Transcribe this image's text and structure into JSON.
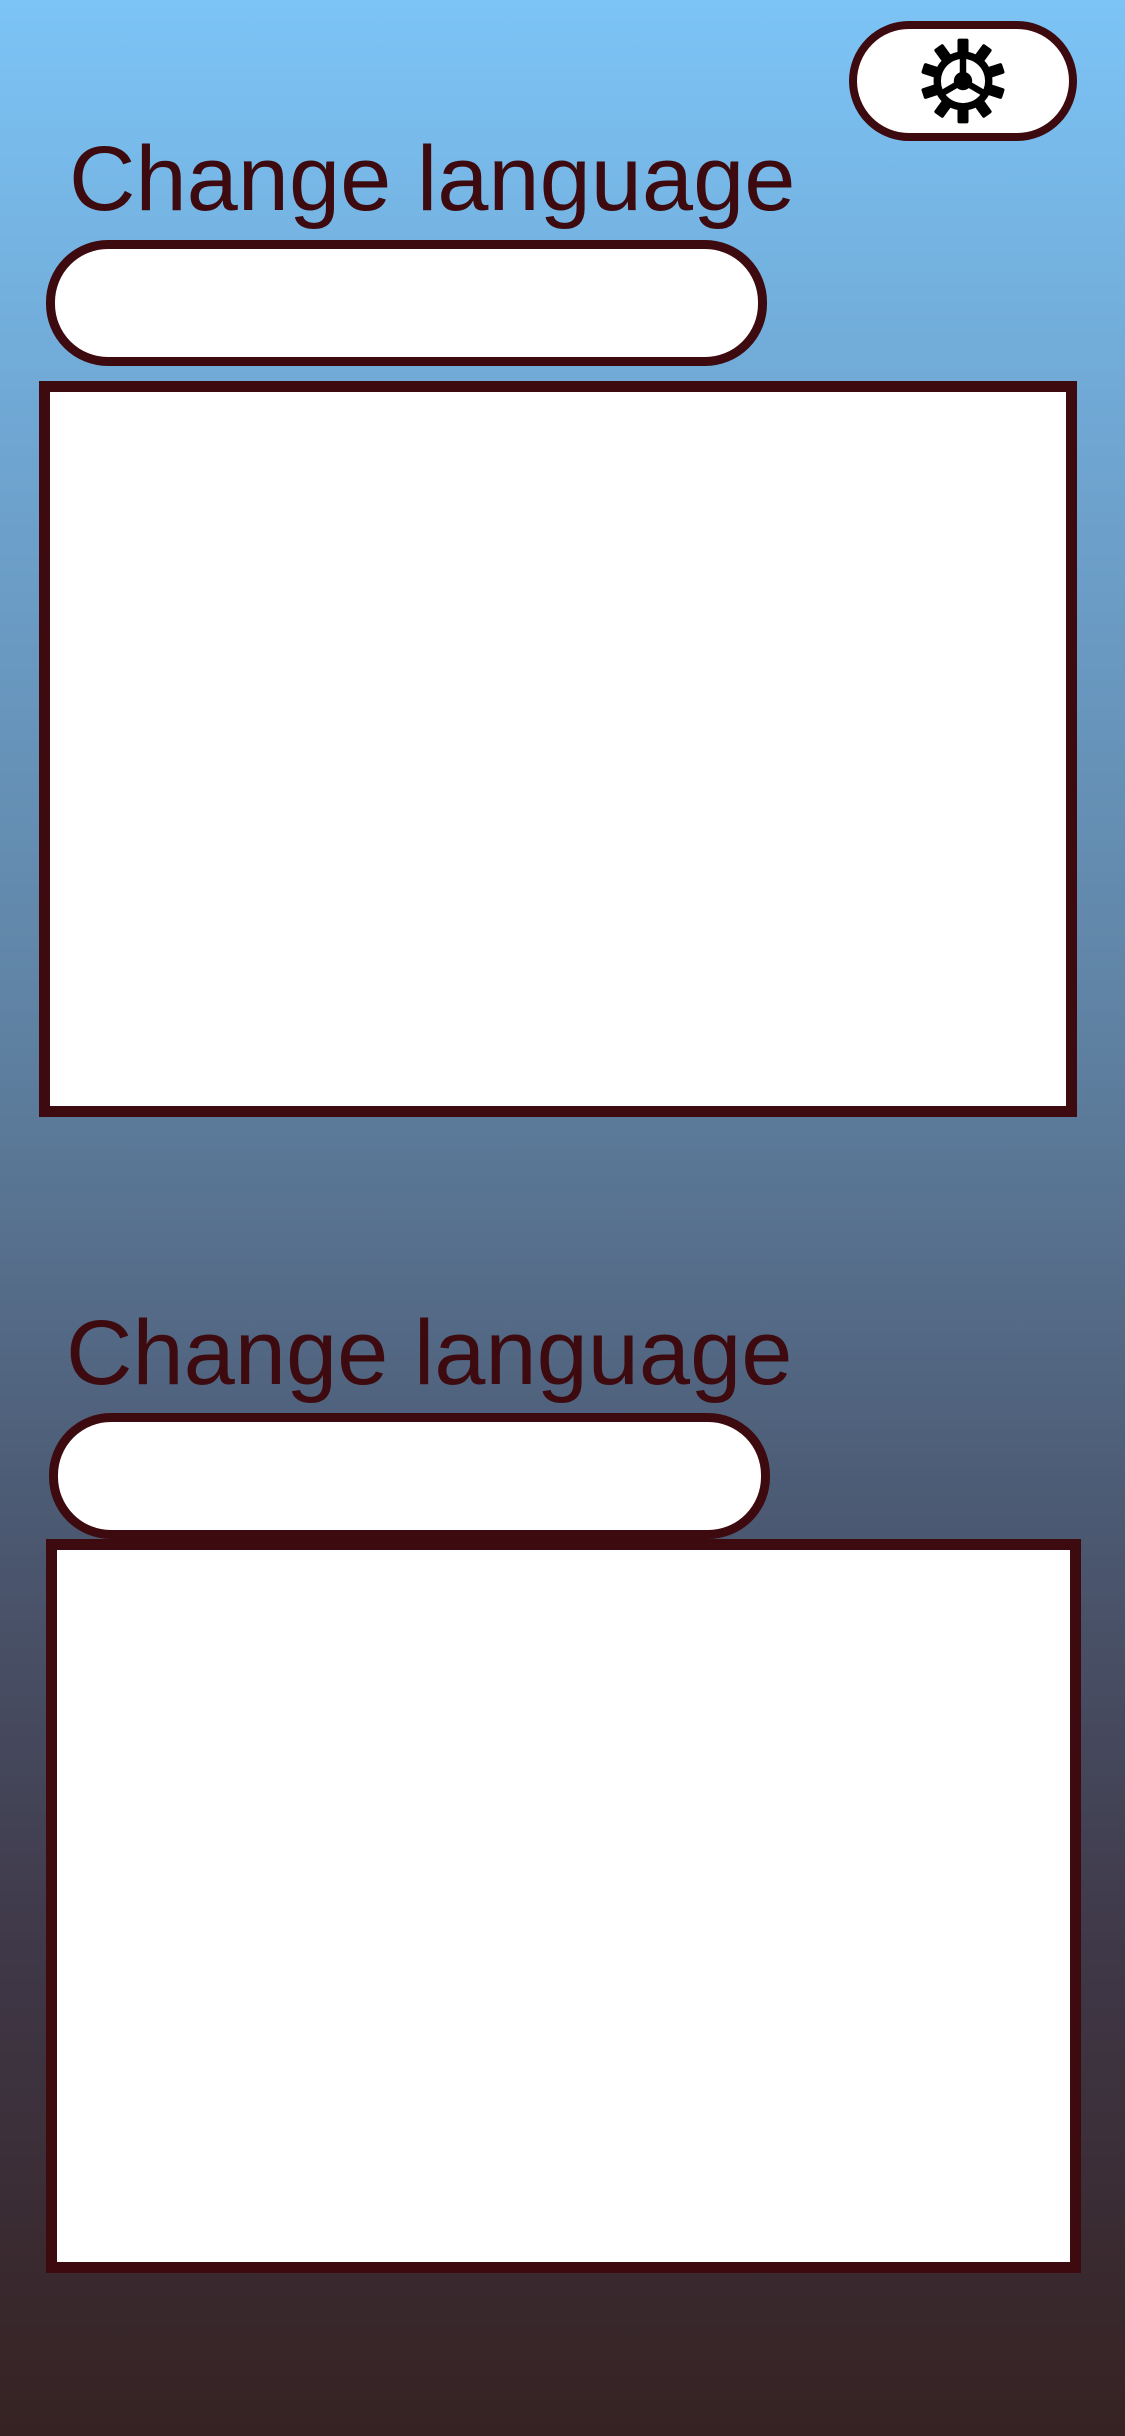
{
  "header": {
    "settings_icon": "gear-icon"
  },
  "sections": [
    {
      "heading": "Change language",
      "input": {
        "value": "",
        "placeholder": ""
      }
    },
    {
      "heading": "Change language",
      "input": {
        "value": "",
        "placeholder": ""
      }
    }
  ],
  "colors": {
    "accent": "#3d0b0f",
    "background_top": "#7cc4f6",
    "background_bottom": "#362222",
    "surface": "#ffffff"
  }
}
